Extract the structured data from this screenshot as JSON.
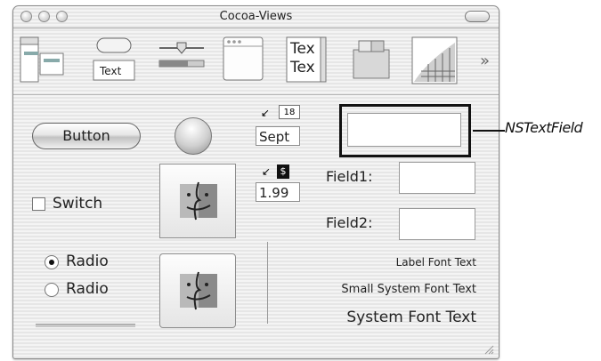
{
  "window": {
    "title": "Cocoa-Views"
  },
  "palette": {
    "tools": [
      {
        "icon": "menu-views-icon"
      },
      {
        "icon": "buttons-and-text-icon",
        "label": "Text"
      },
      {
        "icon": "slider-progress-icon"
      },
      {
        "icon": "window-icon"
      },
      {
        "icon": "text-views-icon",
        "label": "Tex"
      },
      {
        "icon": "containers-icon"
      },
      {
        "icon": "graphics-views-icon"
      }
    ],
    "overflow": "»"
  },
  "controls": {
    "button_label": "Button",
    "switch_label": "Switch",
    "radio_labels": [
      "Radio",
      "Radio"
    ],
    "date_field_value": "Sept",
    "date_badge": "18",
    "currency_field_value": "1.99",
    "currency_badge": "$",
    "field1_label": "Field1:",
    "field2_label": "Field2:",
    "label_font_text": "Label Font Text",
    "small_system_font_text": "Small System Font Text",
    "system_font_text": "System Font Text"
  },
  "annotation": {
    "label": "NSTextField"
  },
  "colors": {
    "window_bg": "#f0f0f0",
    "border": "#8a8a8a",
    "highlight": "#111111"
  }
}
